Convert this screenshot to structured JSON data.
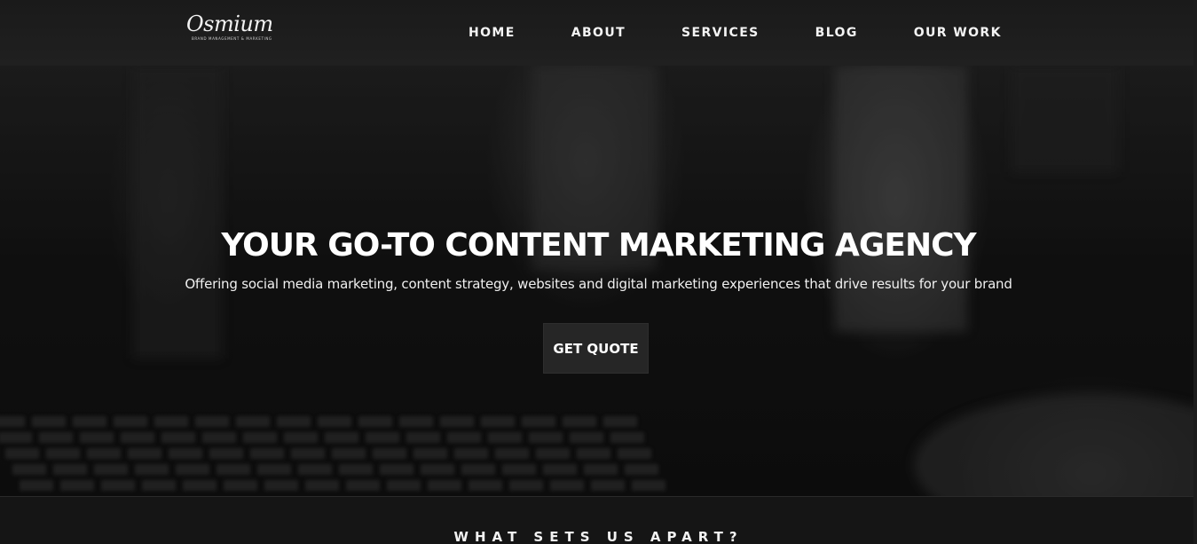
{
  "header": {
    "logo": {
      "name": "Osmium",
      "tagline": "BRAND MANAGEMENT & MARKETING"
    },
    "nav": [
      "HOME",
      "ABOUT",
      "SERVICES",
      "BLOG",
      "OUR WORK"
    ]
  },
  "hero": {
    "title": "YOUR GO-TO CONTENT MARKETING AGENCY",
    "subtitle": "Offering social media marketing, content strategy, websites and digital marketing experiences that drive results for your brand",
    "cta_label": "GET QUOTE"
  },
  "section": {
    "title": "WHAT SETS US APART?"
  },
  "colors": {
    "header_bg": "#1d1d1d",
    "cta_bg": "#262626",
    "text": "#ffffff"
  }
}
